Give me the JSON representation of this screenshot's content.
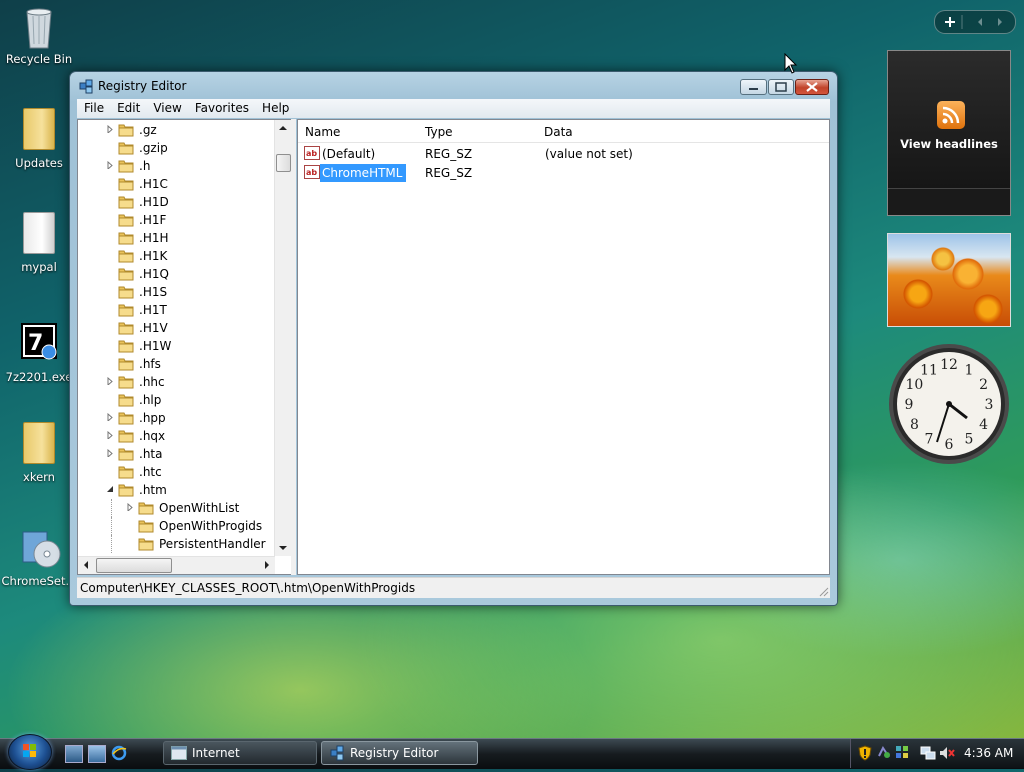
{
  "desktop": {
    "icons": [
      {
        "label": "Recycle Bin"
      },
      {
        "label": "Updates"
      },
      {
        "label": "mypal"
      },
      {
        "label": "7z2201.exe"
      },
      {
        "label": "xkern"
      },
      {
        "label": "ChromeSet..."
      }
    ]
  },
  "window": {
    "title": "Registry Editor",
    "menu": [
      "File",
      "Edit",
      "View",
      "Favorites",
      "Help"
    ],
    "tree": [
      {
        "label": ".gz",
        "has_children": true
      },
      {
        "label": ".gzip",
        "has_children": false
      },
      {
        "label": ".h",
        "has_children": true
      },
      {
        "label": ".H1C",
        "has_children": false
      },
      {
        "label": ".H1D",
        "has_children": false
      },
      {
        "label": ".H1F",
        "has_children": false
      },
      {
        "label": ".H1H",
        "has_children": false
      },
      {
        "label": ".H1K",
        "has_children": false
      },
      {
        "label": ".H1Q",
        "has_children": false
      },
      {
        "label": ".H1S",
        "has_children": false
      },
      {
        "label": ".H1T",
        "has_children": false
      },
      {
        "label": ".H1V",
        "has_children": false
      },
      {
        "label": ".H1W",
        "has_children": false
      },
      {
        "label": ".hfs",
        "has_children": false
      },
      {
        "label": ".hhc",
        "has_children": true
      },
      {
        "label": ".hlp",
        "has_children": false
      },
      {
        "label": ".hpp",
        "has_children": true
      },
      {
        "label": ".hqx",
        "has_children": true
      },
      {
        "label": ".hta",
        "has_children": true
      },
      {
        "label": ".htc",
        "has_children": false
      },
      {
        "label": ".htm",
        "has_children": true,
        "expanded": true
      },
      {
        "label": "OpenWithList",
        "has_children": true,
        "child": true
      },
      {
        "label": "OpenWithProgids",
        "has_children": false,
        "child": true
      },
      {
        "label": "PersistentHandler",
        "has_children": false,
        "child": true
      }
    ],
    "columns": {
      "name": "Name",
      "type": "Type",
      "data": "Data"
    },
    "values": [
      {
        "name": "(Default)",
        "type": "REG_SZ",
        "data": "(value not set)",
        "selected": false
      },
      {
        "name": "ChromeHTML",
        "type": "REG_SZ",
        "data": "",
        "selected": true
      }
    ],
    "status_path": "Computer\\HKEY_CLASSES_ROOT\\.htm\\OpenWithProgids"
  },
  "gadgets": {
    "news_label": "View headlines",
    "clock_numbers": [
      "12",
      "1",
      "2",
      "3",
      "4",
      "5",
      "6",
      "7",
      "8",
      "9",
      "10",
      "11"
    ]
  },
  "taskbar": {
    "buttons": [
      {
        "label": "Internet",
        "active": false
      },
      {
        "label": "Registry Editor",
        "active": true
      }
    ],
    "time": "4:36 AM"
  },
  "colors": {
    "selection": "#3399ff",
    "close_button": "#c1432a"
  }
}
